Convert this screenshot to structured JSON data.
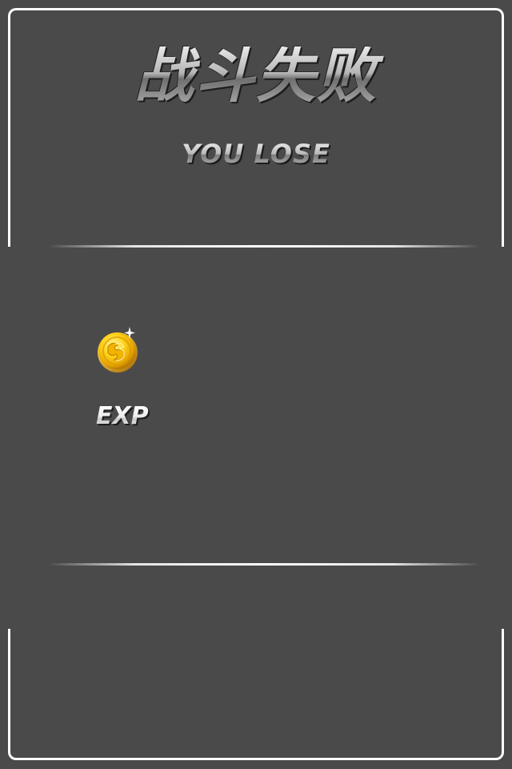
{
  "screen": {
    "background_color": "#4a4a4a",
    "frame_color": "#ffffff"
  },
  "header": {
    "title_cn": "战斗失败",
    "title_en": "YOU LOSE"
  },
  "rewards": {
    "gold_icon": "gold-coin-icon",
    "exp_label": "EXP"
  }
}
